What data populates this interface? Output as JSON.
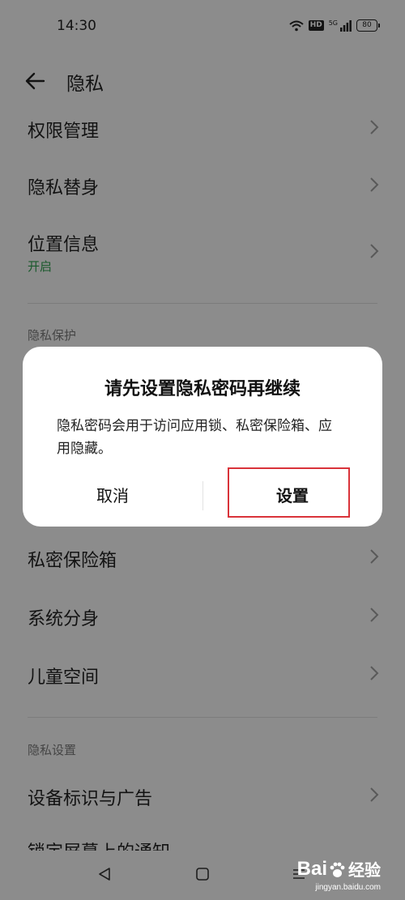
{
  "status_bar": {
    "time": "14:30",
    "network_label": "5G",
    "hd_label": "HD",
    "battery": "80"
  },
  "header": {
    "title": "隐私"
  },
  "items": {
    "permissions": "权限管理",
    "privacy_avatar": "隐私替身",
    "location": {
      "label": "位置信息",
      "status": "开启"
    },
    "private_safe": "私密保险箱",
    "system_clone": "系统分身",
    "kids_space": "儿童空间",
    "device_id_ads": "设备标识与广告",
    "lockscreen_notifications": "锁定屏幕上的通知"
  },
  "sections": {
    "privacy_protection": "隐私保护",
    "privacy_settings": "隐私设置"
  },
  "dialog": {
    "title": "请先设置隐私密码再继续",
    "message": "隐私密码会用于访问应用锁、私密保险箱、应用隐藏。",
    "cancel_label": "取消",
    "confirm_label": "设置"
  },
  "watermark": {
    "brand": "Bai",
    "brand_cn": "经验",
    "url": "jingyan.baidu.com"
  },
  "colors": {
    "accent_status": "#2e9a4d",
    "highlight": "#d9333a"
  }
}
